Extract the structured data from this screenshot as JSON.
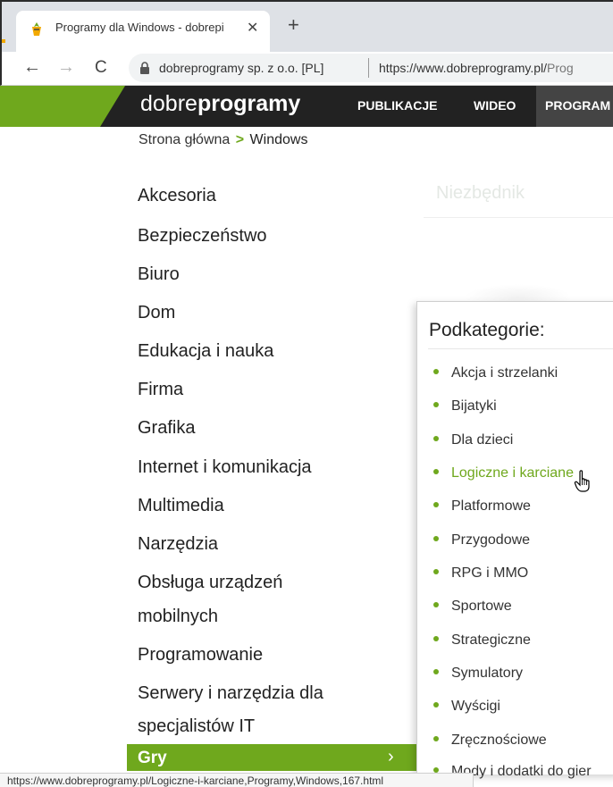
{
  "browser": {
    "tab_title": "Programy dla Windows - dobrepi",
    "tab_close": "✕",
    "new_tab": "+",
    "nav": {
      "back": "←",
      "forward": "→",
      "reload": "C"
    },
    "site_identity": "dobreprogramy sp. z o.o. [PL]",
    "url_host": "https://www.dobreprogramy.pl/",
    "url_path": "Prog",
    "status_url": "https://www.dobreprogramy.pl/Logiczne-i-karciane,Programy,Windows,167.html"
  },
  "header": {
    "logo_light": "dobre",
    "logo_bold": "programy",
    "nav": [
      "PUBLIKACJE",
      "WIDEO",
      "PROGRAM"
    ]
  },
  "breadcrumb": {
    "home": "Strona główna",
    "separator": ">",
    "current": "Windows"
  },
  "categories": [
    "Akcesoria",
    "Bezpieczeństwo",
    "Biuro",
    "Dom",
    "Edukacja i nauka",
    "Firma",
    "Grafika",
    "Internet i komunikacja",
    "Multimedia",
    "Narzędzia",
    "Obsługa urządzeń",
    "mobilnych",
    "Programowanie",
    "Serwery i narzędzia dla",
    "specjalistów IT"
  ],
  "active_category": {
    "label": "Gry",
    "arrow": "›"
  },
  "side_box": {
    "title": "Niezbędnik"
  },
  "subcategories": {
    "title": "Podkategorie:",
    "items": [
      "Akcja i strzelanki",
      "Bijatyki",
      "Dla dzieci",
      "Logiczne i karciane",
      "Platformowe",
      "Przygodowe",
      "RPG i MMO",
      "Sportowe",
      "Strategiczne",
      "Symulatory",
      "Wyścigi",
      "Zręcznościowe",
      "Mody i dodatki do gier"
    ],
    "hovered_index": 3
  },
  "colors": {
    "accent_green": "#6fa81d",
    "header_dark": "#222222"
  },
  "icons": [
    "favicon-icon",
    "lock-icon",
    "pointer-cursor-icon"
  ]
}
